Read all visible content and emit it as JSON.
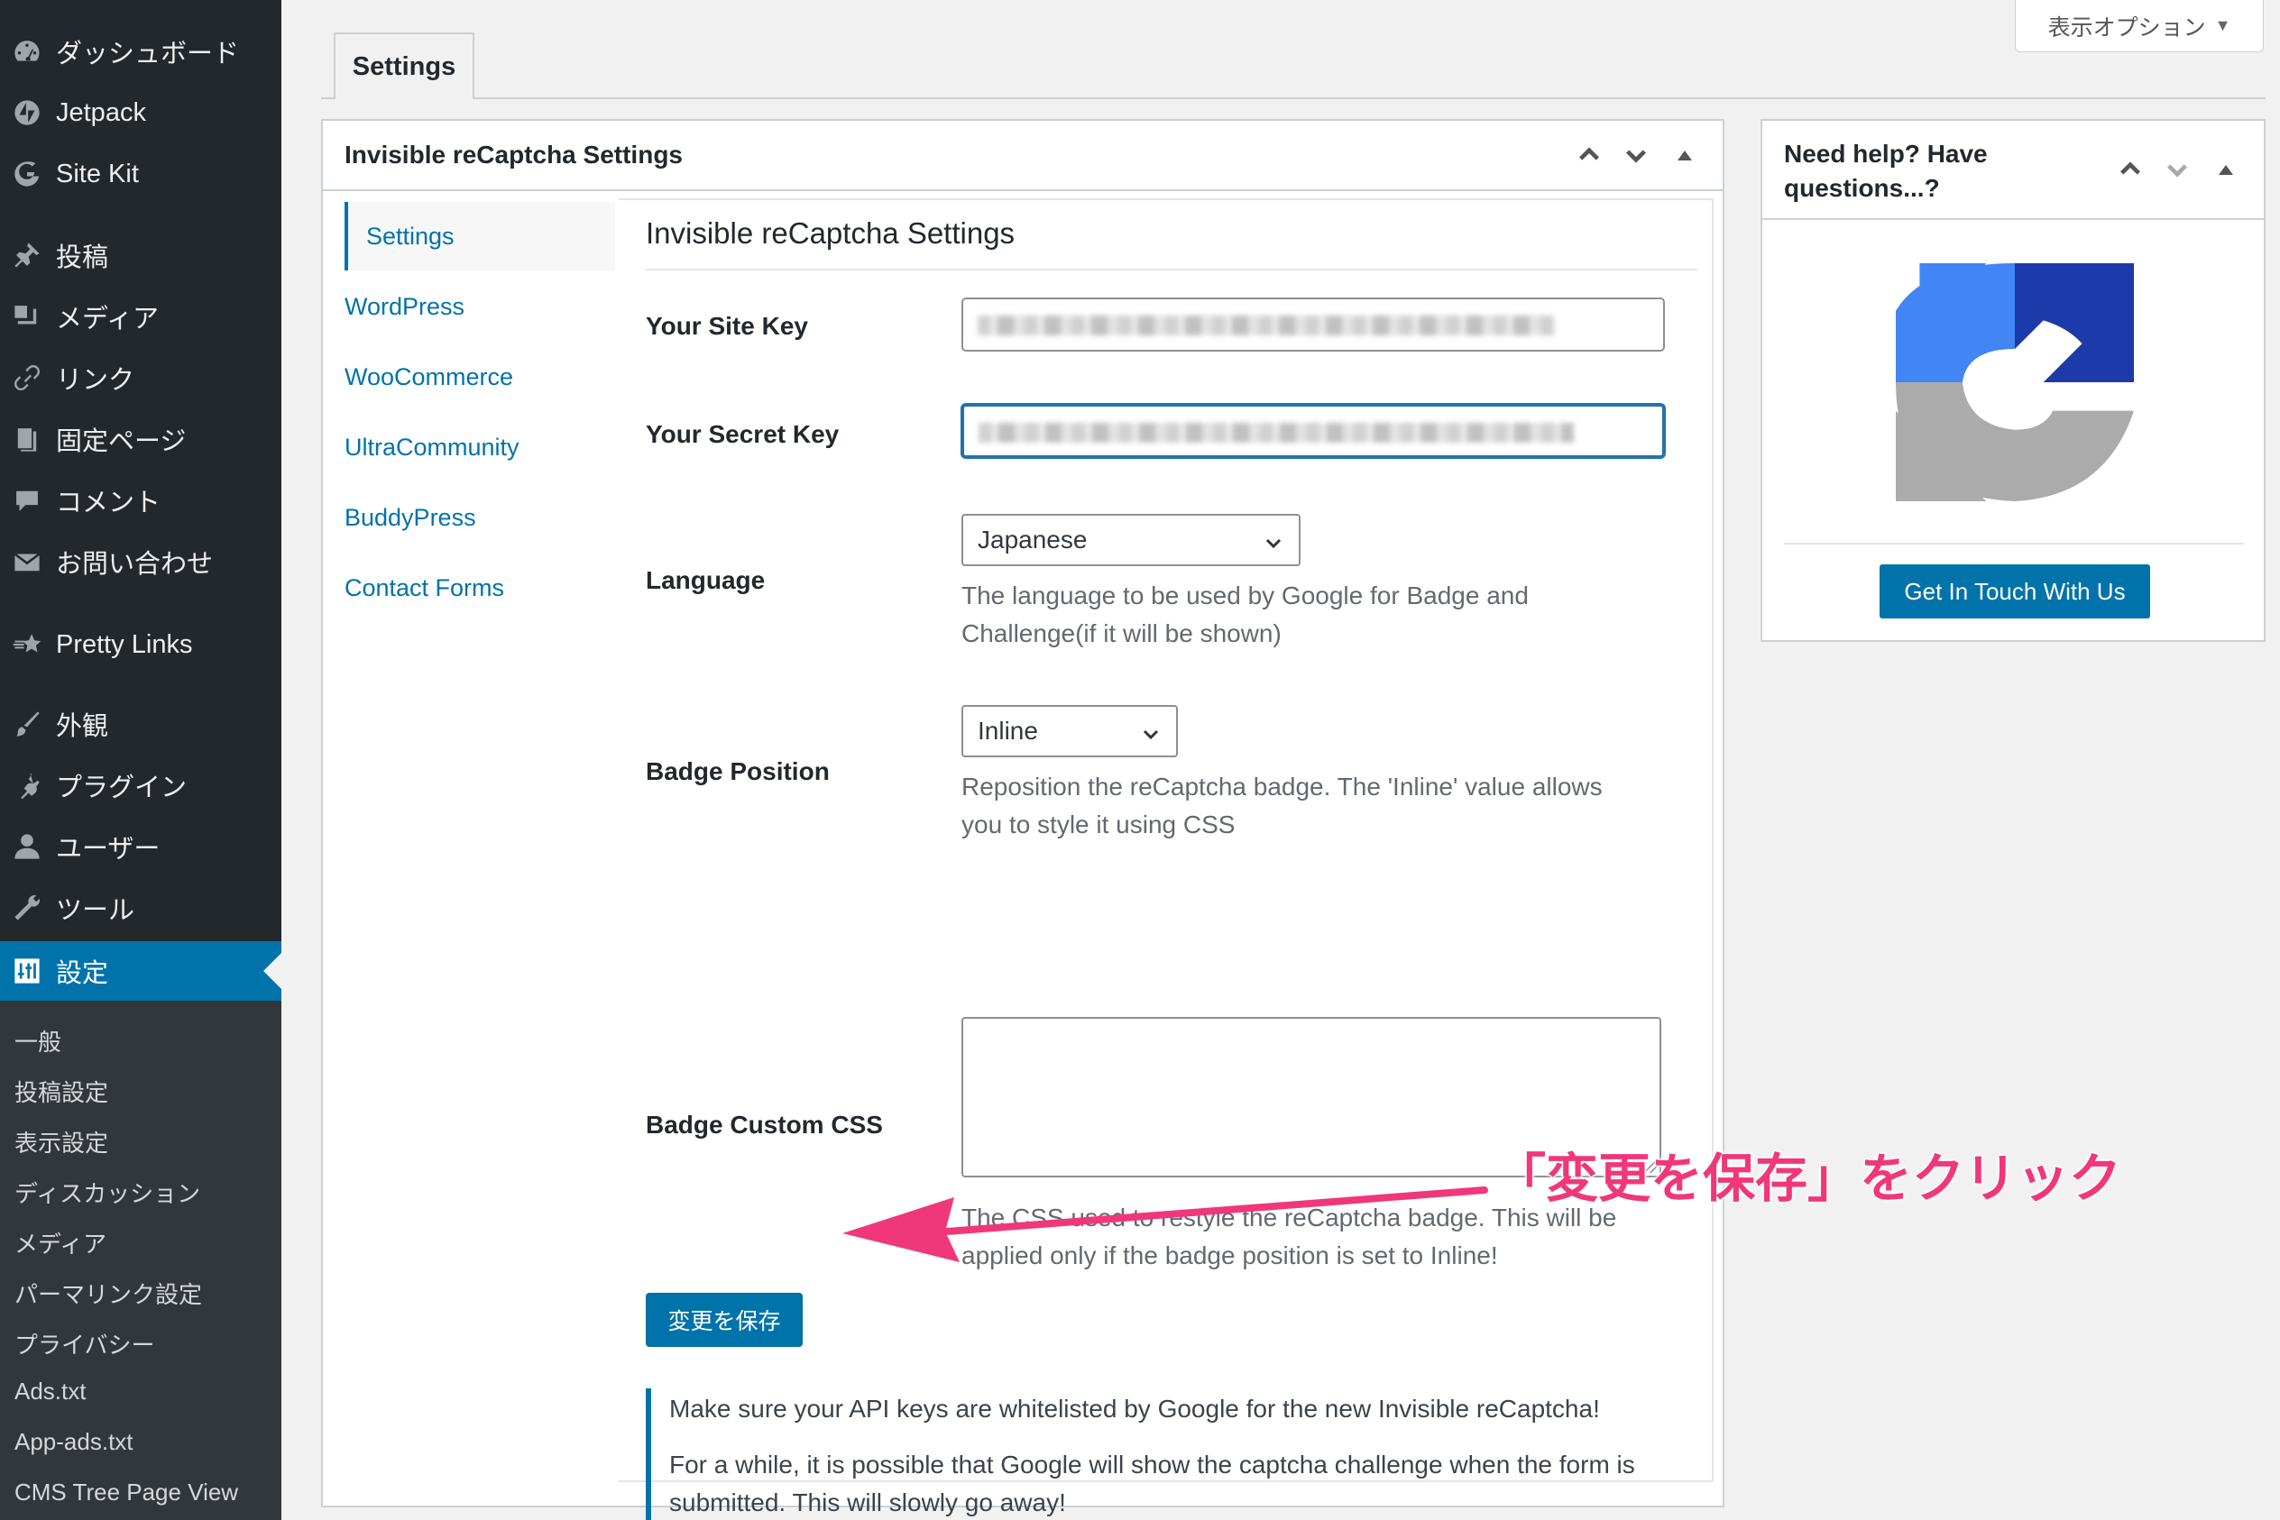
{
  "sidebar": {
    "menu": [
      {
        "label": "ダッシュボード",
        "icon": "dashboard-icon"
      },
      {
        "label": "Jetpack",
        "icon": "jetpack-icon"
      },
      {
        "label": "Site Kit",
        "icon": "google-g-icon"
      },
      {
        "label": "投稿",
        "icon": "pin-icon"
      },
      {
        "label": "メディア",
        "icon": "media-icon"
      },
      {
        "label": "リンク",
        "icon": "link-icon"
      },
      {
        "label": "固定ページ",
        "icon": "page-icon"
      },
      {
        "label": "コメント",
        "icon": "comment-icon"
      },
      {
        "label": "お問い合わせ",
        "icon": "mail-icon"
      },
      {
        "label": "Pretty Links",
        "icon": "star-icon"
      },
      {
        "label": "外観",
        "icon": "brush-icon"
      },
      {
        "label": "プラグイン",
        "icon": "plugin-icon"
      },
      {
        "label": "ユーザー",
        "icon": "user-icon"
      },
      {
        "label": "ツール",
        "icon": "wrench-icon"
      },
      {
        "label": "設定",
        "icon": "settings-icon"
      }
    ],
    "submenu": [
      "一般",
      "投稿設定",
      "表示設定",
      "ディスカッション",
      "メディア",
      "パーマリンク設定",
      "プライバシー",
      "Ads.txt",
      "App-ads.txt",
      "CMS Tree Page View"
    ]
  },
  "top": {
    "screen_options": "表示オプション",
    "tab": "Settings"
  },
  "main_box": {
    "title": "Invisible reCaptcha Settings",
    "nav_tabs": [
      "Settings",
      "WordPress",
      "WooCommerce",
      "UltraCommunity",
      "BuddyPress",
      "Contact Forms"
    ],
    "content_title": "Invisible reCaptcha Settings",
    "site_key_label": "Your Site Key",
    "secret_key_label": "Your Secret Key",
    "language_label": "Language",
    "language_value": "Japanese",
    "language_desc": "The language to be used by Google for Badge and Challenge(if it will be shown)",
    "badge_position_label": "Badge Position",
    "badge_position_value": "Inline",
    "badge_position_desc": "Reposition the reCaptcha badge. The 'Inline' value allows you to style it using CSS",
    "badge_css_label": "Badge Custom CSS",
    "badge_css_value": "",
    "badge_css_desc": "The CSS used to restyle the reCaptcha badge. This will be applied only if the badge position is set to Inline!",
    "save_label": "変更を保存",
    "notice_1": "Make sure your API keys are whitelisted by Google for the new Invisible reCaptcha!",
    "notice_2": "For a while, it is possible that Google will show the captcha challenge when the form is submitted. This will slowly go away!"
  },
  "side_box": {
    "title": "Need help? Have questions...?",
    "button": "Get In Touch With Us"
  },
  "annotation": "「変更を保存」をクリック",
  "colors": {
    "accent": "#0073aa",
    "sidebar": "#23282d",
    "annotation": "#f0377a"
  }
}
